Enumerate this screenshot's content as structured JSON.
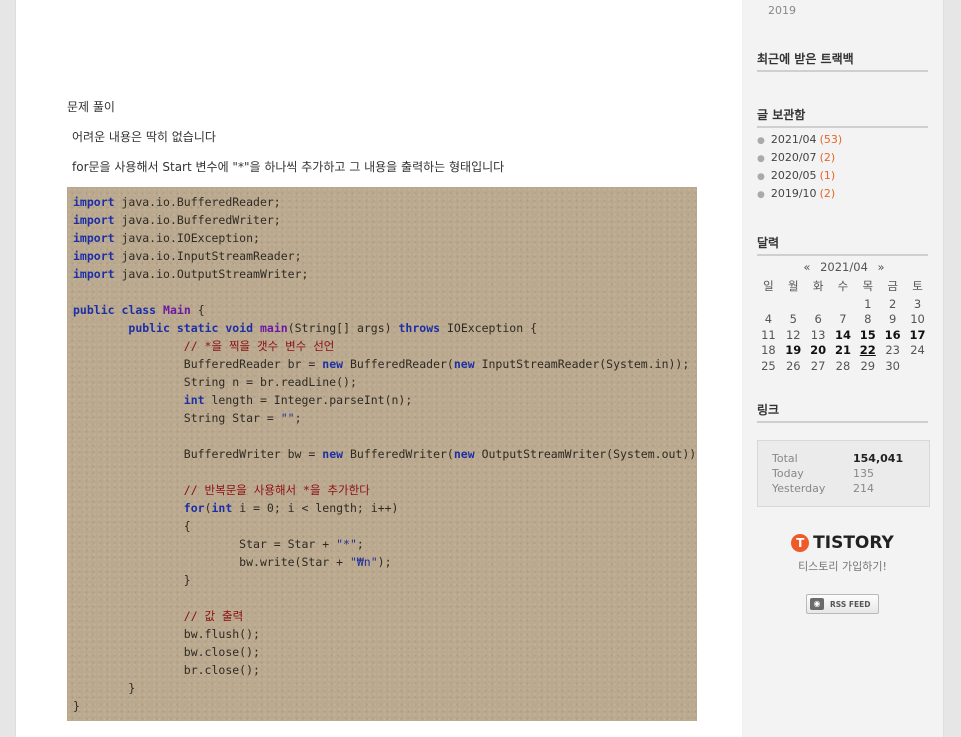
{
  "post": {
    "heading": "문제 풀이",
    "line1": "어려운 내용은 딱히 없습니다",
    "line2": "for문을 사용해서 Start 변수에 \"*\"을 하나씩 추가하고 그 내용을 출력하는 형태입니다"
  },
  "code": {
    "imports": [
      "java.io.BufferedReader;",
      "java.io.BufferedWriter;",
      "java.io.IOException;",
      "java.io.InputStreamReader;",
      "java.io.OutputStreamWriter;"
    ],
    "keywords": {
      "import": "import",
      "public": "public",
      "class": "class",
      "static": "static",
      "void": "void",
      "throws": "throws",
      "new": "new",
      "int": "int",
      "for": "for"
    },
    "class_name": "Main",
    "method_name": "main",
    "main_params": "(String[] args)",
    "exception": "IOException {",
    "comment1": "// *을 찍을 갯수 변수 선언",
    "br_decl": "BufferedReader br = ",
    "br_ctor": "BufferedReader(",
    "isr_ctor": "InputStreamReader(System.in));",
    "read_line": "String n = br.readLine();",
    "length_decl": "length = Integer.parseInt(n);",
    "star_decl": "String Star = ",
    "empty_str": "\"\"",
    "semicolon": ";",
    "bw_decl": "BufferedWriter bw = ",
    "bw_ctor": "BufferedWriter(",
    "osw_ctor": "OutputStreamWriter(System.out));",
    "comment2": "// 반복문을 사용해서 *을 추가한다",
    "for_open": "(",
    "for_rest": "i = 0; i < length; i++)",
    "brace_open": "{",
    "brace_close": "}",
    "star_add": "Star = Star + ",
    "star_str": "\"*\"",
    "write_call": "bw.write(Star + ",
    "newline_str": "\"₩n\"",
    "write_end": ");",
    "comment3": "// 값 출력",
    "flush": "bw.flush();",
    "bw_close": "bw.close();",
    "br_close": "br.close();"
  },
  "sidebar": {
    "year_tail": "2019",
    "trackback_title": "최근에 받은 트랙백",
    "archive_title": "글 보관함",
    "archive": [
      {
        "month": "2021/04",
        "count": "(53)"
      },
      {
        "month": "2020/07",
        "count": "(2)"
      },
      {
        "month": "2020/05",
        "count": "(1)"
      },
      {
        "month": "2019/10",
        "count": "(2)"
      }
    ],
    "calendar_title": "달력",
    "calendar": {
      "prev": "«",
      "month": "2021/04",
      "next": "»",
      "weekdays": [
        "일",
        "월",
        "화",
        "수",
        "목",
        "금",
        "토"
      ],
      "weeks": [
        [
          "",
          "",
          "",
          "",
          "1",
          "2",
          "3"
        ],
        [
          "4",
          "5",
          "6",
          "7",
          "8",
          "9",
          "10"
        ],
        [
          "11",
          "12",
          "13",
          "14",
          "15",
          "16",
          "17"
        ],
        [
          "18",
          "19",
          "20",
          "21",
          "22",
          "23",
          "24"
        ],
        [
          "25",
          "26",
          "27",
          "28",
          "29",
          "30",
          ""
        ]
      ]
    },
    "links_title": "링크",
    "counter": {
      "total_label": "Total",
      "total": "154,041",
      "today_label": "Today",
      "today": "135",
      "yesterday_label": "Yesterday",
      "yesterday": "214"
    },
    "tistory_mark": "T",
    "tistory_word": "TISTORY",
    "tistory_join": "티스토리 가입하기!",
    "rss_label": "RSS FEED"
  },
  "colors": {
    "code_bg": "#bba98f",
    "keyword": "#1d2fa5",
    "comment": "#8b1010",
    "accent_count": "#e3672a",
    "tistory_orange": "#ef5a28"
  }
}
